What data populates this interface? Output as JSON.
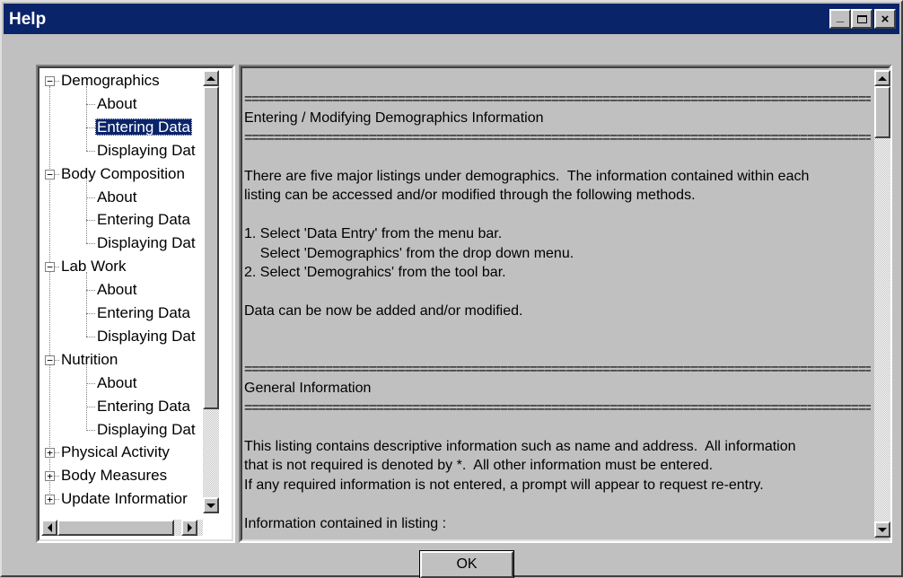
{
  "window": {
    "title": "Help",
    "controls": {
      "minimize": "_",
      "maximize": "□",
      "close": "×"
    }
  },
  "tree": {
    "items": [
      {
        "label": "Demographics",
        "expanded": true,
        "expander": "−"
      },
      {
        "label": "About"
      },
      {
        "label": "Entering Data",
        "selected": true
      },
      {
        "label": "Displaying Dat"
      },
      {
        "label": "Body Composition",
        "expanded": true,
        "expander": "−"
      },
      {
        "label": "About"
      },
      {
        "label": "Entering Data"
      },
      {
        "label": "Displaying Dat"
      },
      {
        "label": "Lab Work",
        "expanded": true,
        "expander": "−"
      },
      {
        "label": "About"
      },
      {
        "label": "Entering Data"
      },
      {
        "label": "Displaying Dat"
      },
      {
        "label": "Nutrition",
        "expanded": true,
        "expander": "−"
      },
      {
        "label": "About"
      },
      {
        "label": "Entering Data"
      },
      {
        "label": "Displaying Dat"
      },
      {
        "label": "Physical Activity",
        "expanded": false,
        "expander": "+"
      },
      {
        "label": "Body Measures",
        "expanded": false,
        "expander": "+"
      },
      {
        "label": "Update Informatior",
        "expanded": false,
        "expander": "+"
      }
    ]
  },
  "content": {
    "lines": [
      "",
      "=========================================================================================",
      "Entering / Modifying Demographics Information",
      "=========================================================================================",
      "",
      "There are five major listings under demographics.  The information contained within each",
      "listing can be accessed and/or modified through the following methods.",
      "",
      "1. Select 'Data Entry' from the menu bar.",
      "    Select 'Demographics' from the drop down menu.",
      "2. Select 'Demograhics' from the tool bar.",
      "",
      "Data can be now be added and/or modified.",
      "",
      "",
      "=========================================================================================",
      "General Information",
      "=========================================================================================",
      "",
      "This listing contains descriptive information such as name and address.  All information",
      "that is not required is denoted by *.  All other information must be entered.",
      "If any required information is not entered, a prompt will appear to request re-entry.",
      "",
      "Information contained in listing :"
    ]
  },
  "buttons": {
    "ok": "OK"
  }
}
